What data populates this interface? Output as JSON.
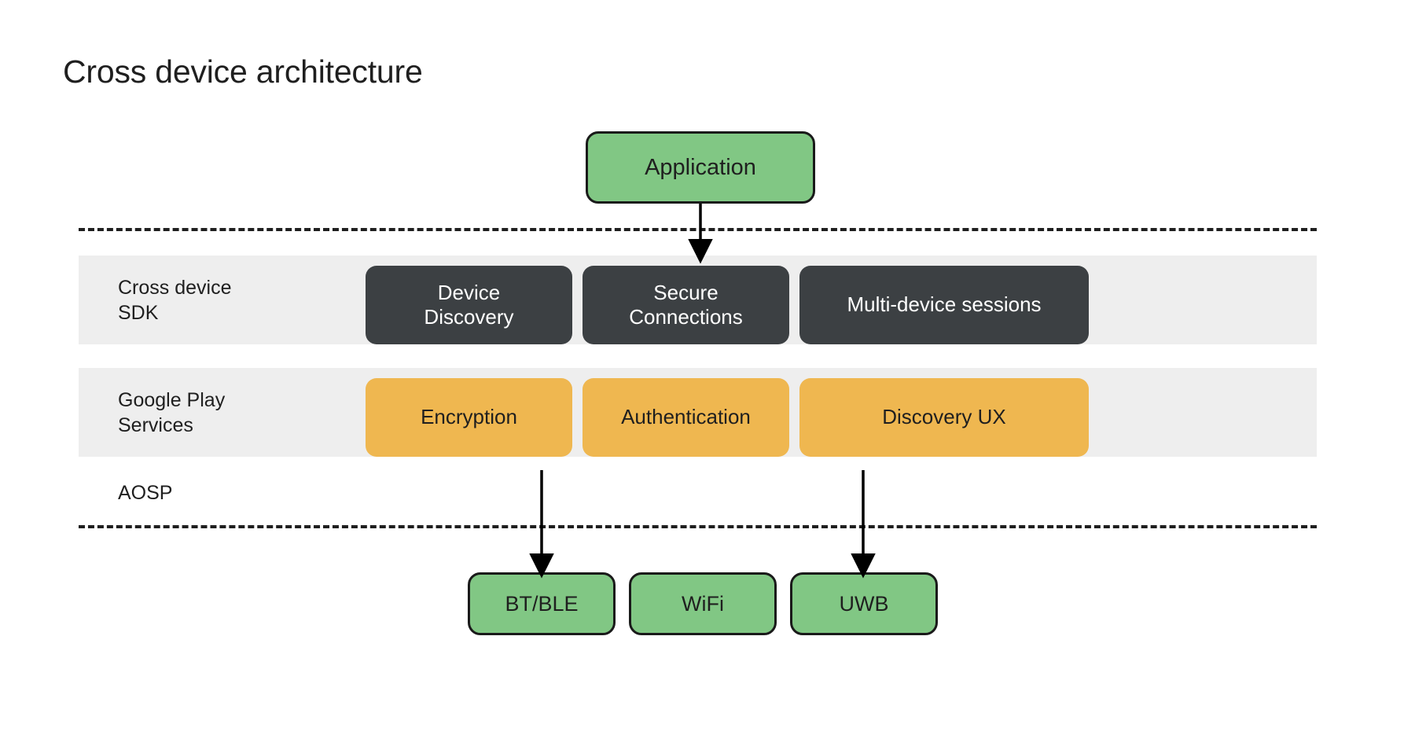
{
  "page": {
    "title": "Cross device architecture",
    "background_color": "#ffffff"
  },
  "colors": {
    "green_node": "#81c784",
    "green_node_border": "#1a1a1a",
    "dark_node": "#3c4043",
    "amber_node": "#efb750",
    "band_gray": "#eeeeee",
    "text_dark": "#1f1f1f",
    "text_light": "#ffffff",
    "arrow": "#000000",
    "dashed_separator": "#1f1f1f"
  },
  "application": {
    "label": "Application"
  },
  "layers": [
    {
      "id": "cross-device-sdk",
      "label": "Cross device\nSDK",
      "style": "dark",
      "items": [
        {
          "label": "Device\nDiscovery"
        },
        {
          "label": "Secure\nConnections"
        },
        {
          "label": "Multi-device sessions"
        }
      ]
    },
    {
      "id": "google-play-services",
      "label": "Google Play\nServices",
      "style": "amber",
      "items": [
        {
          "label": "Encryption"
        },
        {
          "label": "Authentication"
        },
        {
          "label": "Discovery UX"
        }
      ]
    }
  ],
  "aosp": {
    "label": "AOSP"
  },
  "transports": [
    {
      "id": "bt-ble",
      "label": "BT/BLE"
    },
    {
      "id": "wifi",
      "label": "WiFi"
    },
    {
      "id": "uwb",
      "label": "UWB"
    }
  ],
  "connections": [
    {
      "from": "Application",
      "to": "Secure Connections"
    },
    {
      "from": "Encryption",
      "to": "BT/BLE"
    },
    {
      "from": "Discovery UX",
      "to": "UWB"
    }
  ],
  "separators": [
    {
      "id": "top-dashed",
      "style": "dashed"
    },
    {
      "id": "bottom-dashed",
      "style": "dashed"
    }
  ]
}
